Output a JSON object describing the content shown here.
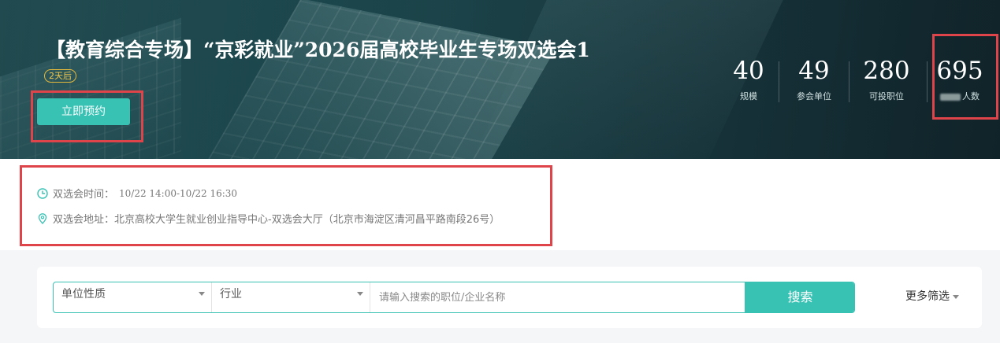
{
  "banner": {
    "title": "【教育综合专场】“京彩就业”2026届高校毕业生专场双选会1",
    "countdown": "2天后",
    "book_label": "立即预约"
  },
  "stats": [
    {
      "value": "40",
      "label": "规模"
    },
    {
      "value": "49",
      "label": "参会单位"
    },
    {
      "value": "280",
      "label": "可投职位"
    },
    {
      "value": "695",
      "label": "人数"
    }
  ],
  "info": {
    "time_label": "双选会时间：",
    "time_value": "10/22 14:00-10/22 16:30",
    "address_label": "双选会地址：",
    "address_value": "北京高校大学生就业创业指导中心-双选会大厅（北京市海淀区清河昌平路南段26号）"
  },
  "search": {
    "unit_type": "单位性质",
    "industry": "行业",
    "placeholder": "请输入搜索的职位/企业名称",
    "button": "搜索",
    "more_filters": "更多筛选"
  },
  "colors": {
    "accent": "#38c2b4",
    "highlight": "#e0444b",
    "countdown": "#e5b93b"
  },
  "icons": [
    "clock-icon",
    "location-pin-icon",
    "chevron-down-icon"
  ]
}
